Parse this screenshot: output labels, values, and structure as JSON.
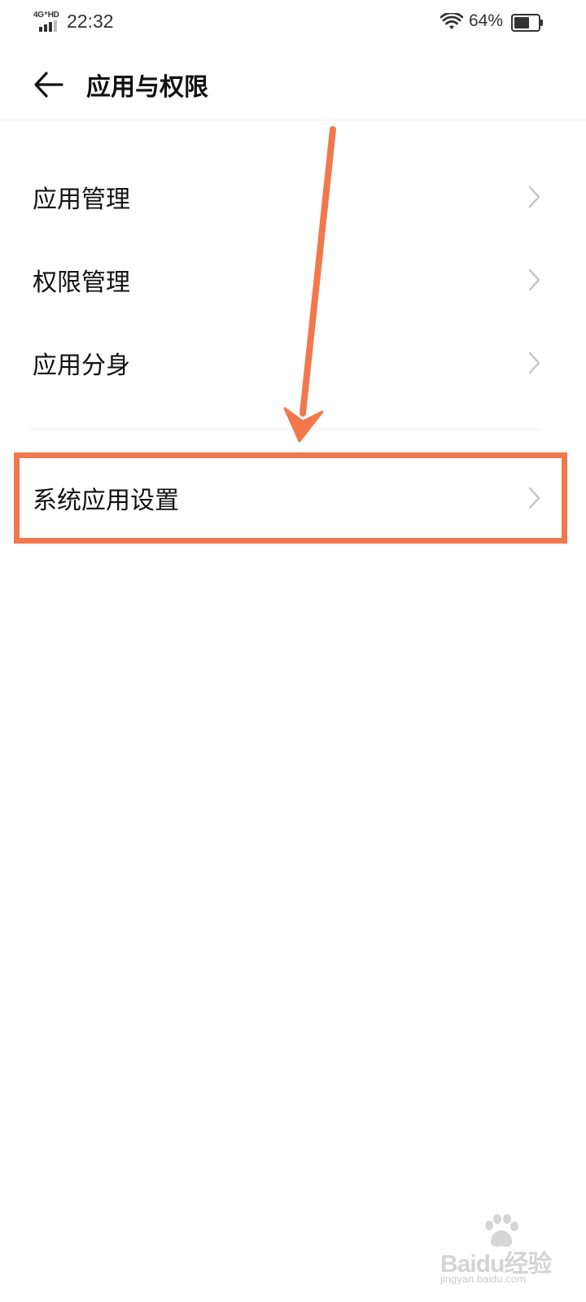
{
  "status_bar": {
    "network_label": "4G⁺HD",
    "time": "22:32",
    "battery_percent": "64%",
    "battery_level": 0.64
  },
  "header": {
    "title": "应用与权限",
    "back_icon": "arrow-left-icon"
  },
  "menu": {
    "items": [
      {
        "label": "应用管理",
        "icon": "chevron-right-icon"
      },
      {
        "label": "权限管理",
        "icon": "chevron-right-icon"
      },
      {
        "label": "应用分身",
        "icon": "chevron-right-icon"
      },
      {
        "label": "系统应用设置",
        "icon": "chevron-right-icon"
      }
    ]
  },
  "annotation": {
    "color": "#f2784b"
  },
  "watermark": {
    "logo_text": "Baidu经验",
    "url": "jingyan.baidu.com"
  }
}
